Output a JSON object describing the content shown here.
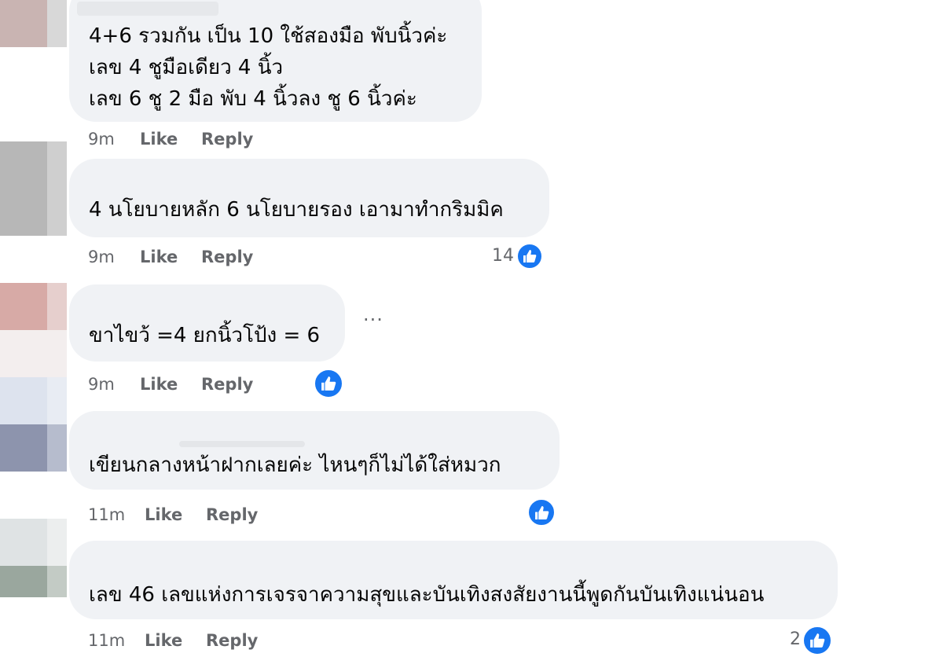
{
  "comments": [
    {
      "lines": [
        "4+6 รวมกัน เป็น 10 ใช้สองมือ พับนิ้วค่ะ",
        "เลข 4 ชูมือเดียว 4 นิ้ว",
        "เลข 6 ชู 2 มือ พับ 4 นิ้วลง ชู 6 นิ้วค่ะ"
      ],
      "time": "9m",
      "like_label": "Like",
      "reply_label": "Reply"
    },
    {
      "lines": [
        "4 นโยบายหลัก 6 นโยบายรอง เอามาทำกริมมิค"
      ],
      "time": "9m",
      "like_label": "Like",
      "reply_label": "Reply",
      "reaction_count": "14",
      "reaction_icon": "thumbs-up-icon"
    },
    {
      "lines": [
        "ขาไขว้ =4 ยกนิ้วโป้ง = 6"
      ],
      "time": "9m",
      "like_label": "Like",
      "reply_label": "Reply",
      "more_label": "···",
      "reaction_icon": "thumbs-up-icon"
    },
    {
      "lines": [
        "เขียนกลางหน้าฝากเลยค่ะ ไหนๆก็ไม่ได้ใส่หมวก"
      ],
      "time": "11m",
      "like_label": "Like",
      "reply_label": "Reply",
      "reaction_icon": "thumbs-up-icon"
    },
    {
      "lines": [
        "เลข 46 เลขแห่งการเจรจาความสุขและบันเทิงสงสัยงานนี้พูดกันบันเทิงแน่นอน"
      ],
      "time": "11m",
      "like_label": "Like",
      "reply_label": "Reply",
      "reaction_count": "2",
      "reaction_icon": "thumbs-up-icon"
    }
  ],
  "colors": {
    "bubble_bg": "#f0f2f5",
    "text": "#050505",
    "meta_text": "#65676b",
    "like_blue": "#1877f2"
  }
}
